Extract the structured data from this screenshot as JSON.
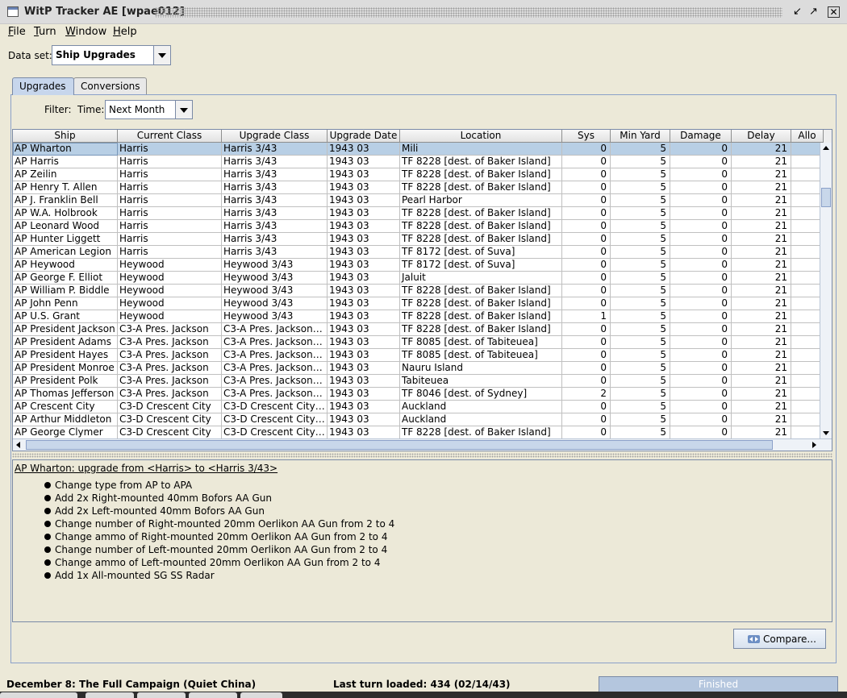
{
  "window": {
    "title": "WitP Tracker AE [wpae012]"
  },
  "menu": [
    "File",
    "Turn",
    "Window",
    "Help"
  ],
  "dataset": {
    "label": "Data set:",
    "value": "Ship Upgrades"
  },
  "tabs": [
    {
      "label": "Upgrades",
      "active": true
    },
    {
      "label": "Conversions",
      "active": false
    }
  ],
  "filter": {
    "label": "Filter:",
    "time_label": "Time:",
    "time_value": "Next Month"
  },
  "table": {
    "columns": [
      "Ship",
      "Current Class",
      "Upgrade Class",
      "Upgrade Date",
      "Location",
      "Sys",
      "Min Yard",
      "Damage",
      "Delay",
      "Allo"
    ],
    "rows": [
      [
        "AP Wharton",
        "Harris",
        "Harris 3/43",
        "1943 03",
        "Mili",
        "0",
        "5",
        "0",
        "21",
        ""
      ],
      [
        "AP Harris",
        "Harris",
        "Harris 3/43",
        "1943 03",
        "TF 8228 [dest. of Baker Island]",
        "0",
        "5",
        "0",
        "21",
        ""
      ],
      [
        "AP Zeilin",
        "Harris",
        "Harris 3/43",
        "1943 03",
        "TF 8228 [dest. of Baker Island]",
        "0",
        "5",
        "0",
        "21",
        ""
      ],
      [
        "AP Henry T. Allen",
        "Harris",
        "Harris 3/43",
        "1943 03",
        "TF 8228 [dest. of Baker Island]",
        "0",
        "5",
        "0",
        "21",
        ""
      ],
      [
        "AP J. Franklin Bell",
        "Harris",
        "Harris 3/43",
        "1943 03",
        "Pearl Harbor",
        "0",
        "5",
        "0",
        "21",
        ""
      ],
      [
        "AP W.A. Holbrook",
        "Harris",
        "Harris 3/43",
        "1943 03",
        "TF 8228 [dest. of Baker Island]",
        "0",
        "5",
        "0",
        "21",
        ""
      ],
      [
        "AP Leonard Wood",
        "Harris",
        "Harris 3/43",
        "1943 03",
        "TF 8228 [dest. of Baker Island]",
        "0",
        "5",
        "0",
        "21",
        ""
      ],
      [
        "AP Hunter Liggett",
        "Harris",
        "Harris 3/43",
        "1943 03",
        "TF 8228 [dest. of Baker Island]",
        "0",
        "5",
        "0",
        "21",
        ""
      ],
      [
        "AP American Legion",
        "Harris",
        "Harris 3/43",
        "1943 03",
        "TF 8172 [dest. of Suva]",
        "0",
        "5",
        "0",
        "21",
        ""
      ],
      [
        "AP Heywood",
        "Heywood",
        "Heywood 3/43",
        "1943 03",
        "TF 8172 [dest. of Suva]",
        "0",
        "5",
        "0",
        "21",
        ""
      ],
      [
        "AP George F. Elliot",
        "Heywood",
        "Heywood 3/43",
        "1943 03",
        "Jaluit",
        "0",
        "5",
        "0",
        "21",
        ""
      ],
      [
        "AP William P. Biddle",
        "Heywood",
        "Heywood 3/43",
        "1943 03",
        "TF 8228 [dest. of Baker Island]",
        "0",
        "5",
        "0",
        "21",
        ""
      ],
      [
        "AP John Penn",
        "Heywood",
        "Heywood 3/43",
        "1943 03",
        "TF 8228 [dest. of Baker Island]",
        "0",
        "5",
        "0",
        "21",
        ""
      ],
      [
        "AP U.S. Grant",
        "Heywood",
        "Heywood 3/43",
        "1943 03",
        "TF 8228 [dest. of Baker Island]",
        "1",
        "5",
        "0",
        "21",
        ""
      ],
      [
        "AP President Jackson",
        "C3-A Pres. Jackson",
        "C3-A Pres. Jackson 3...",
        "1943 03",
        "TF 8228 [dest. of Baker Island]",
        "0",
        "5",
        "0",
        "21",
        ""
      ],
      [
        "AP President Adams",
        "C3-A Pres. Jackson",
        "C3-A Pres. Jackson 3...",
        "1943 03",
        "TF 8085 [dest. of Tabiteuea]",
        "0",
        "5",
        "0",
        "21",
        ""
      ],
      [
        "AP President Hayes",
        "C3-A Pres. Jackson",
        "C3-A Pres. Jackson 3...",
        "1943 03",
        "TF 8085 [dest. of Tabiteuea]",
        "0",
        "5",
        "0",
        "21",
        ""
      ],
      [
        "AP President Monroe",
        "C3-A Pres. Jackson",
        "C3-A Pres. Jackson 3...",
        "1943 03",
        "Nauru Island",
        "0",
        "5",
        "0",
        "21",
        ""
      ],
      [
        "AP President Polk",
        "C3-A Pres. Jackson",
        "C3-A Pres. Jackson 3...",
        "1943 03",
        "Tabiteuea",
        "0",
        "5",
        "0",
        "21",
        ""
      ],
      [
        "AP Thomas Jefferson",
        "C3-A Pres. Jackson",
        "C3-A Pres. Jackson 3...",
        "1943 03",
        "TF 8046 [dest. of Sydney]",
        "2",
        "5",
        "0",
        "21",
        ""
      ],
      [
        "AP Crescent City",
        "C3-D Crescent City",
        "C3-D Crescent City 3/...",
        "1943 03",
        "Auckland",
        "0",
        "5",
        "0",
        "21",
        ""
      ],
      [
        "AP Arthur Middleton",
        "C3-D Crescent City",
        "C3-D Crescent City 3/...",
        "1943 03",
        "Auckland",
        "0",
        "5",
        "0",
        "21",
        ""
      ],
      [
        "AP George Clymer",
        "C3-D Crescent City",
        "C3-D Crescent City 3/...",
        "1943 03",
        "TF 8228 [dest. of Baker Island]",
        "0",
        "5",
        "0",
        "21",
        ""
      ]
    ]
  },
  "details": {
    "heading": "AP Wharton: upgrade from <Harris> to <Harris 3/43>",
    "items": [
      "Change type from AP to APA",
      "Add 2x Right-mounted 40mm Bofors AA Gun",
      "Add 2x Left-mounted 40mm Bofors AA Gun",
      "Change number of Right-mounted 20mm Oerlikon AA Gun from 2 to 4",
      "Change ammo of Right-mounted 20mm Oerlikon AA Gun from 2 to 4",
      "Change number of Left-mounted 20mm Oerlikon AA Gun from 2 to 4",
      "Change ammo of Left-mounted 20mm Oerlikon AA Gun from 2 to 4",
      "Add 1x All-mounted SG SS Radar"
    ]
  },
  "compare_button": {
    "label": "Compare...",
    "icon": "compare-arrows-icon"
  },
  "status": {
    "scenario": "December 8: The Full Campaign (Quiet China)",
    "last_turn": "Last turn loaded: 434 (02/14/43)",
    "progress_text": "Finished",
    "progress_fraction": 1.0
  },
  "colors": {
    "selected_row": "#b8cfe5",
    "tab_active": "#c7d6ec",
    "progress_fill": "#b4c6de"
  }
}
